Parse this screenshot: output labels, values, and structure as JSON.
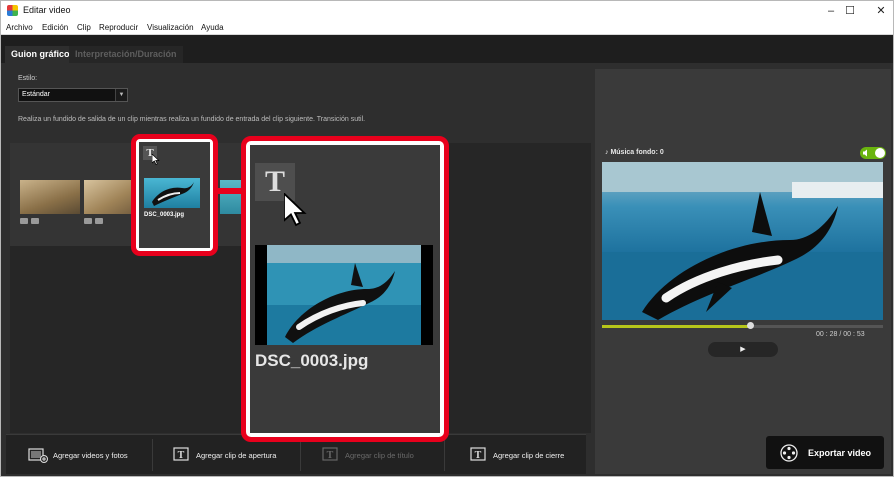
{
  "window": {
    "title": "Editar video",
    "controls": [
      "–",
      "☐",
      "✕"
    ]
  },
  "menu": [
    "Archivo",
    "Edición",
    "Clip",
    "Reproducir",
    "Visualización",
    "Ayuda"
  ],
  "tabs": [
    {
      "label": "Guion gráfico",
      "active": true
    },
    {
      "label": "Interpretación/Duración",
      "active": false
    }
  ],
  "style": {
    "label": "Estilo:",
    "value": "Estándar",
    "description": "Realiza un fundido de salida de un clip mientras realiza un fundido de entrada del clip siguiente. Transición sutil."
  },
  "clip": {
    "filename": "DSC_0003.jpg",
    "title_glyph": "T"
  },
  "bottom_actions": [
    {
      "label": "Agregar videos y fotos",
      "icon": "film-add-icon",
      "enabled": true
    },
    {
      "label": "Agregar clip de apertura",
      "icon": "title-clip-icon",
      "enabled": true
    },
    {
      "label": "Agregar clip de título",
      "icon": "title-clip-icon",
      "enabled": false
    },
    {
      "label": "Agregar clip de cierre",
      "icon": "title-clip-icon",
      "enabled": true
    }
  ],
  "music": {
    "label": "Música fondo: 0",
    "enabled": true
  },
  "playback": {
    "current": "00 : 28",
    "separator": "/",
    "total": "00 : 53",
    "progress": 0.5283,
    "play_glyph": "▶"
  },
  "export": {
    "label": "Exportar video"
  },
  "colors": {
    "highlight": "#e8001c",
    "accent": "#6ab40e"
  }
}
